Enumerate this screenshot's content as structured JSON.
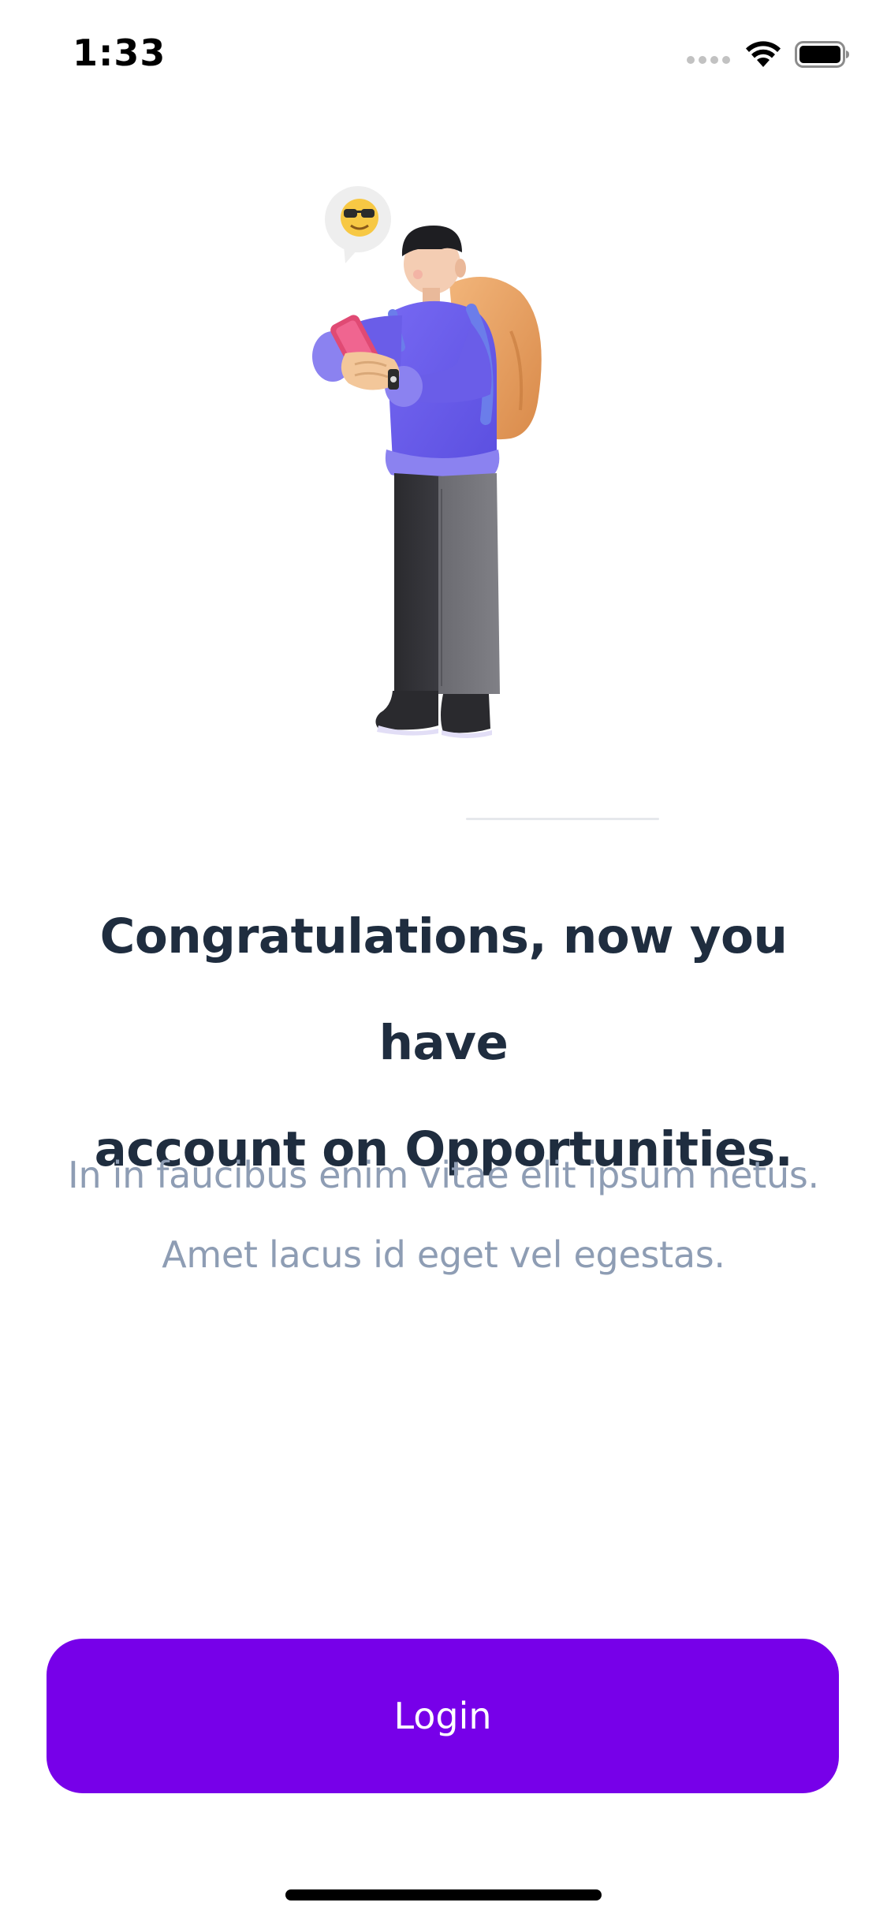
{
  "status_bar": {
    "time": "1:33",
    "icons": [
      "cellular-signal-icon",
      "wifi-icon",
      "battery-icon"
    ]
  },
  "illustration": {
    "name": "person-with-phone-and-backpack-illustration",
    "emoji_bubble": "sunglasses-emoji-icon"
  },
  "main": {
    "heading_line1": "Congratulations, now you have",
    "heading_line2": "account on Opportunities.",
    "subtitle_line1": "In in faucibus enim vitae elit ipsum netus.",
    "subtitle_line2": "Amet lacus id eget vel egestas."
  },
  "actions": {
    "login_label": "Login"
  },
  "colors": {
    "accent": "#7700e9",
    "heading": "#1f2d3f",
    "subtitle": "#8e9db4",
    "background": "#ffffff"
  }
}
